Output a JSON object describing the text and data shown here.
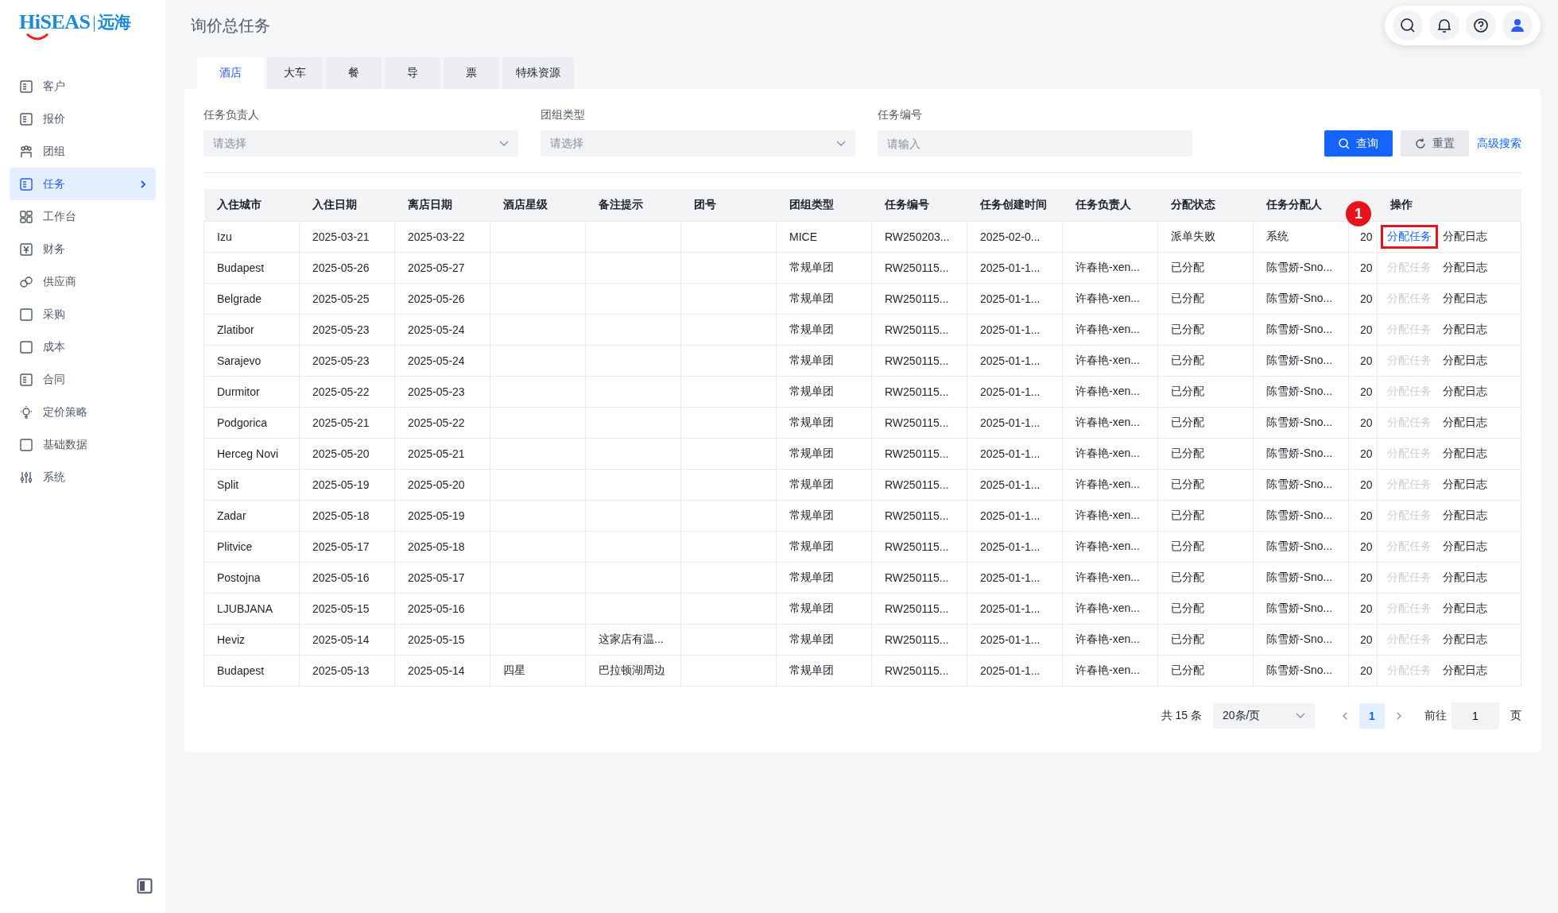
{
  "logo": {
    "brand": "HiSEAS",
    "name": "远海"
  },
  "sidebar": {
    "items": [
      {
        "label": "客户",
        "selected": false
      },
      {
        "label": "报价",
        "selected": false
      },
      {
        "label": "团组",
        "selected": false
      },
      {
        "label": "任务",
        "selected": true
      },
      {
        "label": "工作台",
        "selected": false
      },
      {
        "label": "财务",
        "selected": false
      },
      {
        "label": "供应商",
        "selected": false
      },
      {
        "label": "采购",
        "selected": false
      },
      {
        "label": "成本",
        "selected": false
      },
      {
        "label": "合同",
        "selected": false
      },
      {
        "label": "定价策略",
        "selected": false
      },
      {
        "label": "基础数据",
        "selected": false
      },
      {
        "label": "系统",
        "selected": false
      }
    ]
  },
  "page_title": "询价总任务",
  "tabs": [
    {
      "label": "酒店",
      "selected": true
    },
    {
      "label": "大车",
      "selected": false
    },
    {
      "label": "餐",
      "selected": false
    },
    {
      "label": "导",
      "selected": false
    },
    {
      "label": "票",
      "selected": false
    },
    {
      "label": "特殊资源",
      "selected": false
    }
  ],
  "filters": [
    {
      "label": "任务负责人",
      "kind": "select",
      "placeholder": "请选择"
    },
    {
      "label": "团组类型",
      "kind": "select",
      "placeholder": "请选择"
    },
    {
      "label": "任务编号",
      "kind": "input",
      "placeholder": "请输入"
    }
  ],
  "buttons": {
    "query": "查询",
    "reset": "重置",
    "advanced": "高级搜索"
  },
  "table": {
    "columns": [
      "入住城市",
      "入住日期",
      "离店日期",
      "酒店星级",
      "备注提示",
      "团号",
      "团组类型",
      "任务编号",
      "任务创建时间",
      "任务负责人",
      "分配状态",
      "任务分配人",
      null,
      "操作"
    ],
    "rows": [
      {
        "cells": [
          "Izu",
          "2025-03-21",
          "2025-03-22",
          null,
          null,
          null,
          "MICE",
          "RW250203...",
          "2025-02-0...",
          null,
          "派单失败",
          "系统",
          "20"
        ],
        "assign": "分配任务",
        "assign_disabled": false,
        "log": "分配日志",
        "marker": "1"
      },
      {
        "cells": [
          "Budapest",
          "2025-05-26",
          "2025-05-27",
          null,
          null,
          null,
          "常规单团",
          "RW250115...",
          "2025-01-1...",
          "许春艳-xen...",
          "已分配",
          "陈雪娇-Sno...",
          "20"
        ],
        "assign": "分配任务",
        "assign_disabled": true,
        "log": "分配日志"
      },
      {
        "cells": [
          "Belgrade",
          "2025-05-25",
          "2025-05-26",
          null,
          null,
          null,
          "常规单团",
          "RW250115...",
          "2025-01-1...",
          "许春艳-xen...",
          "已分配",
          "陈雪娇-Sno...",
          "20"
        ],
        "assign": "分配任务",
        "assign_disabled": true,
        "log": "分配日志"
      },
      {
        "cells": [
          "Zlatibor",
          "2025-05-23",
          "2025-05-24",
          null,
          null,
          null,
          "常规单团",
          "RW250115...",
          "2025-01-1...",
          "许春艳-xen...",
          "已分配",
          "陈雪娇-Sno...",
          "20"
        ],
        "assign": "分配任务",
        "assign_disabled": true,
        "log": "分配日志"
      },
      {
        "cells": [
          "Sarajevo",
          "2025-05-23",
          "2025-05-24",
          null,
          null,
          null,
          "常规单团",
          "RW250115...",
          "2025-01-1...",
          "许春艳-xen...",
          "已分配",
          "陈雪娇-Sno...",
          "20"
        ],
        "assign": "分配任务",
        "assign_disabled": true,
        "log": "分配日志"
      },
      {
        "cells": [
          "Durmitor",
          "2025-05-22",
          "2025-05-23",
          null,
          null,
          null,
          "常规单团",
          "RW250115...",
          "2025-01-1...",
          "许春艳-xen...",
          "已分配",
          "陈雪娇-Sno...",
          "20"
        ],
        "assign": "分配任务",
        "assign_disabled": true,
        "log": "分配日志"
      },
      {
        "cells": [
          "Podgorica",
          "2025-05-21",
          "2025-05-22",
          null,
          null,
          null,
          "常规单团",
          "RW250115...",
          "2025-01-1...",
          "许春艳-xen...",
          "已分配",
          "陈雪娇-Sno...",
          "20"
        ],
        "assign": "分配任务",
        "assign_disabled": true,
        "log": "分配日志"
      },
      {
        "cells": [
          "Herceg Novi",
          "2025-05-20",
          "2025-05-21",
          null,
          null,
          null,
          "常规单团",
          "RW250115...",
          "2025-01-1...",
          "许春艳-xen...",
          "已分配",
          "陈雪娇-Sno...",
          "20"
        ],
        "assign": "分配任务",
        "assign_disabled": true,
        "log": "分配日志"
      },
      {
        "cells": [
          "Split",
          "2025-05-19",
          "2025-05-20",
          null,
          null,
          null,
          "常规单团",
          "RW250115...",
          "2025-01-1...",
          "许春艳-xen...",
          "已分配",
          "陈雪娇-Sno...",
          "20"
        ],
        "assign": "分配任务",
        "assign_disabled": true,
        "log": "分配日志"
      },
      {
        "cells": [
          "Zadar",
          "2025-05-18",
          "2025-05-19",
          null,
          null,
          null,
          "常规单团",
          "RW250115...",
          "2025-01-1...",
          "许春艳-xen...",
          "已分配",
          "陈雪娇-Sno...",
          "20"
        ],
        "assign": "分配任务",
        "assign_disabled": true,
        "log": "分配日志"
      },
      {
        "cells": [
          "Plitvice",
          "2025-05-17",
          "2025-05-18",
          null,
          null,
          null,
          "常规单团",
          "RW250115...",
          "2025-01-1...",
          "许春艳-xen...",
          "已分配",
          "陈雪娇-Sno...",
          "20"
        ],
        "assign": "分配任务",
        "assign_disabled": true,
        "log": "分配日志"
      },
      {
        "cells": [
          "Postojna",
          "2025-05-16",
          "2025-05-17",
          null,
          null,
          null,
          "常规单团",
          "RW250115...",
          "2025-01-1...",
          "许春艳-xen...",
          "已分配",
          "陈雪娇-Sno...",
          "20"
        ],
        "assign": "分配任务",
        "assign_disabled": true,
        "log": "分配日志"
      },
      {
        "cells": [
          "LJUBJANA",
          "2025-05-15",
          "2025-05-16",
          null,
          null,
          null,
          "常规单团",
          "RW250115...",
          "2025-01-1...",
          "许春艳-xen...",
          "已分配",
          "陈雪娇-Sno...",
          "20"
        ],
        "assign": "分配任务",
        "assign_disabled": true,
        "log": "分配日志"
      },
      {
        "cells": [
          "Heviz",
          "2025-05-14",
          "2025-05-15",
          null,
          "这家店有温...",
          null,
          "常规单团",
          "RW250115...",
          "2025-01-1...",
          "许春艳-xen...",
          "已分配",
          "陈雪娇-Sno...",
          "20"
        ],
        "assign": "分配任务",
        "assign_disabled": true,
        "log": "分配日志"
      },
      {
        "cells": [
          "Budapest",
          "2025-05-13",
          "2025-05-14",
          "四星",
          "巴拉顿湖周边",
          null,
          "常规单团",
          "RW250115...",
          "2025-01-1...",
          "许春艳-xen...",
          "已分配",
          "陈雪娇-Sno...",
          "20"
        ],
        "assign": "分配任务",
        "assign_disabled": true,
        "log": "分配日志"
      }
    ]
  },
  "pagination": {
    "total": "共 15 条",
    "page_size": "20条/页",
    "pages": [
      {
        "label": "1",
        "selected": true
      }
    ],
    "goto_label": "前往",
    "goto_value": "1",
    "goto_suffix": "页"
  }
}
